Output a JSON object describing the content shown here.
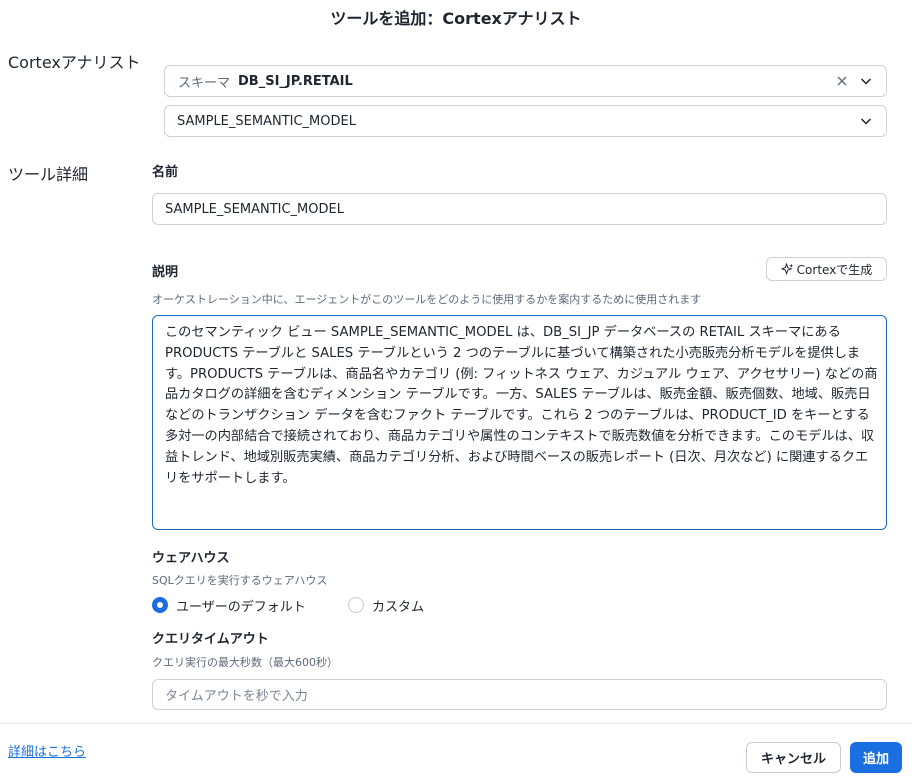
{
  "dialog": {
    "title": "ツールを追加：Cortexアナリスト"
  },
  "analyst_section": {
    "label": "Cortexアナリスト",
    "schema_select": {
      "prefix": "スキーマ",
      "value": "DB_SI_JP.RETAIL"
    },
    "model_select": {
      "value": "SAMPLE_SEMANTIC_MODEL"
    }
  },
  "tool_details": {
    "label": "ツール詳細",
    "name": {
      "label": "名前",
      "value": "SAMPLE_SEMANTIC_MODEL"
    },
    "description": {
      "label": "説明",
      "generate_button": "Cortexで生成",
      "helper": "オーケストレーション中に、エージェントがこのツールをどのように使用するかを案内するために使用されます",
      "value": "このセマンティック ビュー SAMPLE_SEMANTIC_MODEL は、DB_SI_JP データベースの RETAIL スキーマにある PRODUCTS テーブルと SALES テーブルという 2 つのテーブルに基づいて構築された小売販売分析モデルを提供します。PRODUCTS テーブルは、商品名やカテゴリ (例: フィットネス ウェア、カジュアル ウェア、アクセサリー) などの商品カタログの詳細を含むディメンション テーブルです。一方、SALES テーブルは、販売金額、販売個数、地域、販売日などのトランザクション データを含むファクト テーブルです。これら 2 つのテーブルは、PRODUCT_ID をキーとする多対一の内部結合で接続されており、商品カテゴリや属性のコンテキストで販売数値を分析できます。このモデルは、収益トレンド、地域別販売実績、商品カテゴリ分析、および時間ベースの販売レポート (日次、月次など) に関連するクエリをサポートします。"
    },
    "warehouse": {
      "label": "ウェアハウス",
      "helper": "SQLクエリを実行するウェアハウス",
      "options": [
        "ユーザーのデフォルト",
        "カスタム"
      ],
      "selected": "ユーザーのデフォルト"
    },
    "timeout": {
      "label": "クエリタイムアウト",
      "helper": "クエリ実行の最大秒数（最大600秒）",
      "placeholder": "タイムアウトを秒で入力"
    }
  },
  "footer": {
    "details_link": "詳細はこちら",
    "cancel": "キャンセル",
    "add": "追加"
  },
  "colors": {
    "accent": "#1a6fe0",
    "border": "#cbd2dc",
    "focus_border": "#1c6bb9",
    "link": "#1a6fe0"
  },
  "icons": [
    "clear-x-icon",
    "chevron-down-icon",
    "sparkle-icon"
  ]
}
